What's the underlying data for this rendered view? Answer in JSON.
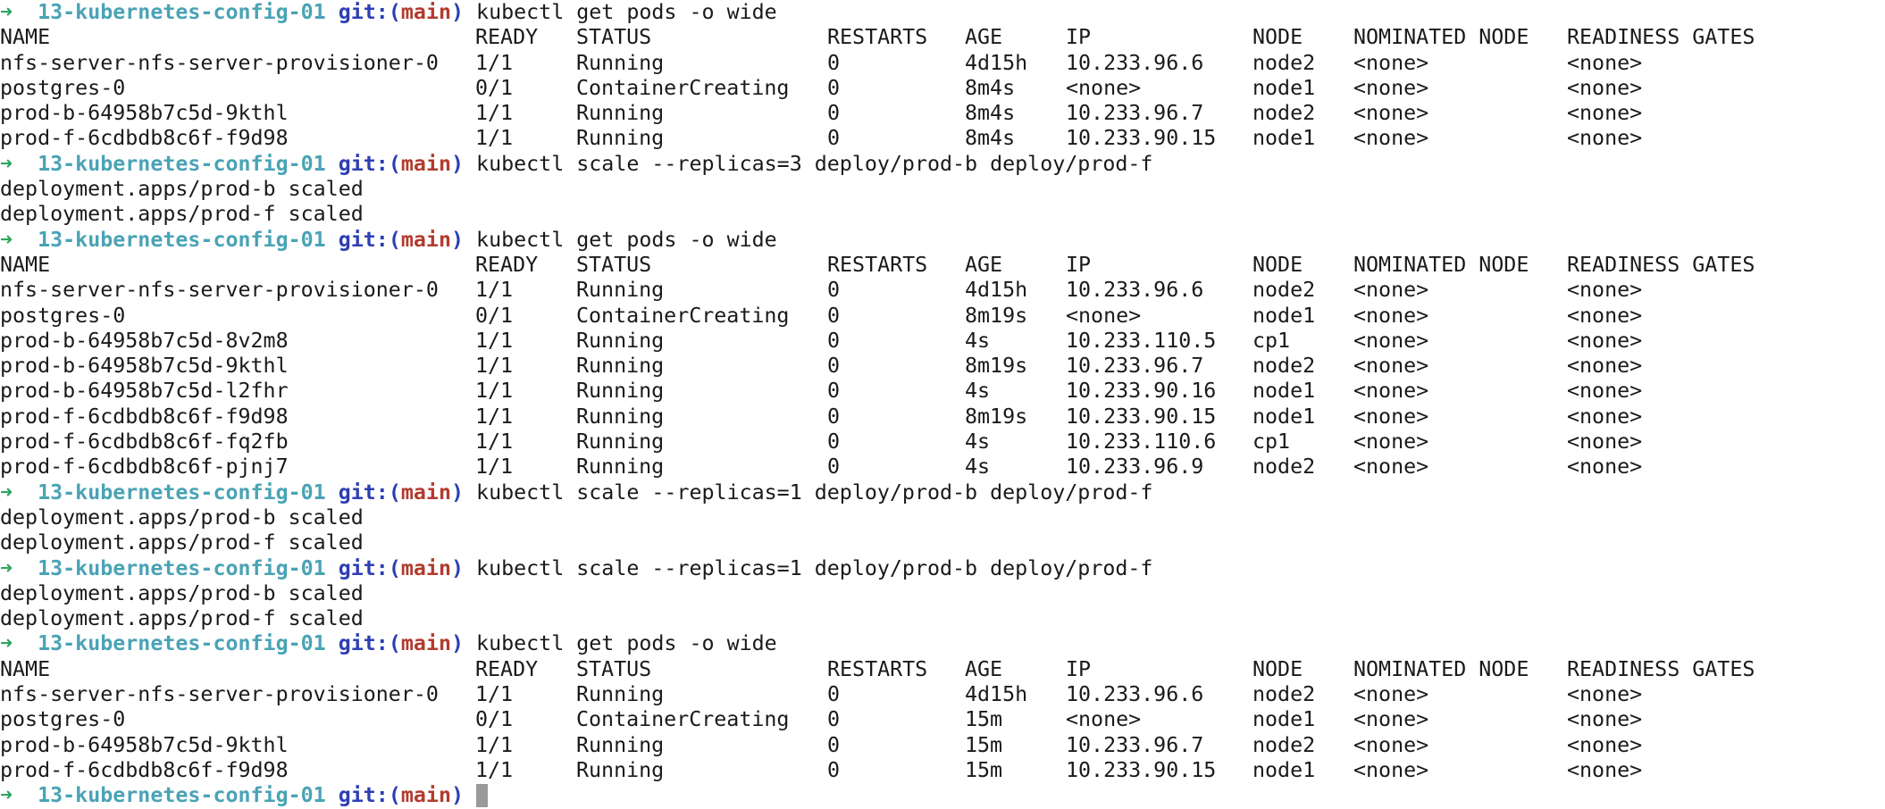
{
  "prompt": {
    "arrow": "➜",
    "dir": "13-kubernetes-config-01",
    "git_label": "git:(",
    "branch": "main",
    "git_close": ")"
  },
  "table_headers": [
    "NAME",
    "READY",
    "STATUS",
    "RESTARTS",
    "AGE",
    "IP",
    "NODE",
    "NOMINATED NODE",
    "READINESS GATES"
  ],
  "blocks": [
    {
      "type": "command",
      "command": "kubectl get pods -o wide",
      "rows": [
        [
          "nfs-server-nfs-server-provisioner-0",
          "1/1",
          "Running",
          "0",
          "4d15h",
          "10.233.96.6",
          "node2",
          "<none>",
          "<none>"
        ],
        [
          "postgres-0",
          "0/1",
          "ContainerCreating",
          "0",
          "8m4s",
          "<none>",
          "node1",
          "<none>",
          "<none>"
        ],
        [
          "prod-b-64958b7c5d-9kthl",
          "1/1",
          "Running",
          "0",
          "8m4s",
          "10.233.96.7",
          "node2",
          "<none>",
          "<none>"
        ],
        [
          "prod-f-6cdbdb8c6f-f9d98",
          "1/1",
          "Running",
          "0",
          "8m4s",
          "10.233.90.15",
          "node1",
          "<none>",
          "<none>"
        ]
      ]
    },
    {
      "type": "command",
      "command": "kubectl scale --replicas=3 deploy/prod-b deploy/prod-f",
      "output": [
        "deployment.apps/prod-b scaled",
        "deployment.apps/prod-f scaled"
      ]
    },
    {
      "type": "command",
      "command": "kubectl get pods -o wide",
      "rows": [
        [
          "nfs-server-nfs-server-provisioner-0",
          "1/1",
          "Running",
          "0",
          "4d15h",
          "10.233.96.6",
          "node2",
          "<none>",
          "<none>"
        ],
        [
          "postgres-0",
          "0/1",
          "ContainerCreating",
          "0",
          "8m19s",
          "<none>",
          "node1",
          "<none>",
          "<none>"
        ],
        [
          "prod-b-64958b7c5d-8v2m8",
          "1/1",
          "Running",
          "0",
          "4s",
          "10.233.110.5",
          "cp1",
          "<none>",
          "<none>"
        ],
        [
          "prod-b-64958b7c5d-9kthl",
          "1/1",
          "Running",
          "0",
          "8m19s",
          "10.233.96.7",
          "node2",
          "<none>",
          "<none>"
        ],
        [
          "prod-b-64958b7c5d-l2fhr",
          "1/1",
          "Running",
          "0",
          "4s",
          "10.233.90.16",
          "node1",
          "<none>",
          "<none>"
        ],
        [
          "prod-f-6cdbdb8c6f-f9d98",
          "1/1",
          "Running",
          "0",
          "8m19s",
          "10.233.90.15",
          "node1",
          "<none>",
          "<none>"
        ],
        [
          "prod-f-6cdbdb8c6f-fq2fb",
          "1/1",
          "Running",
          "0",
          "4s",
          "10.233.110.6",
          "cp1",
          "<none>",
          "<none>"
        ],
        [
          "prod-f-6cdbdb8c6f-pjnj7",
          "1/1",
          "Running",
          "0",
          "4s",
          "10.233.96.9",
          "node2",
          "<none>",
          "<none>"
        ]
      ]
    },
    {
      "type": "command",
      "command": "kubectl scale --replicas=1 deploy/prod-b deploy/prod-f",
      "output": [
        "deployment.apps/prod-b scaled",
        "deployment.apps/prod-f scaled"
      ]
    },
    {
      "type": "command",
      "command": "kubectl scale --replicas=1 deploy/prod-b deploy/prod-f",
      "output": [
        "deployment.apps/prod-b scaled",
        "deployment.apps/prod-f scaled"
      ]
    },
    {
      "type": "command",
      "command": "kubectl get pods -o wide",
      "rows": [
        [
          "nfs-server-nfs-server-provisioner-0",
          "1/1",
          "Running",
          "0",
          "4d15h",
          "10.233.96.6",
          "node2",
          "<none>",
          "<none>"
        ],
        [
          "postgres-0",
          "0/1",
          "ContainerCreating",
          "0",
          "15m",
          "<none>",
          "node1",
          "<none>",
          "<none>"
        ],
        [
          "prod-b-64958b7c5d-9kthl",
          "1/1",
          "Running",
          "0",
          "15m",
          "10.233.96.7",
          "node2",
          "<none>",
          "<none>"
        ],
        [
          "prod-f-6cdbdb8c6f-f9d98",
          "1/1",
          "Running",
          "0",
          "15m",
          "10.233.90.15",
          "node1",
          "<none>",
          "<none>"
        ]
      ]
    },
    {
      "type": "prompt_only",
      "command": ""
    }
  ],
  "colors": {
    "arrow": "#2ba55b",
    "dir": "#4aa3b5",
    "git": "#2d3fb3",
    "branch": "#b23b2e",
    "text": "#1a1a1a",
    "background": "#ffffff",
    "cursor": "#9a9a9a"
  }
}
